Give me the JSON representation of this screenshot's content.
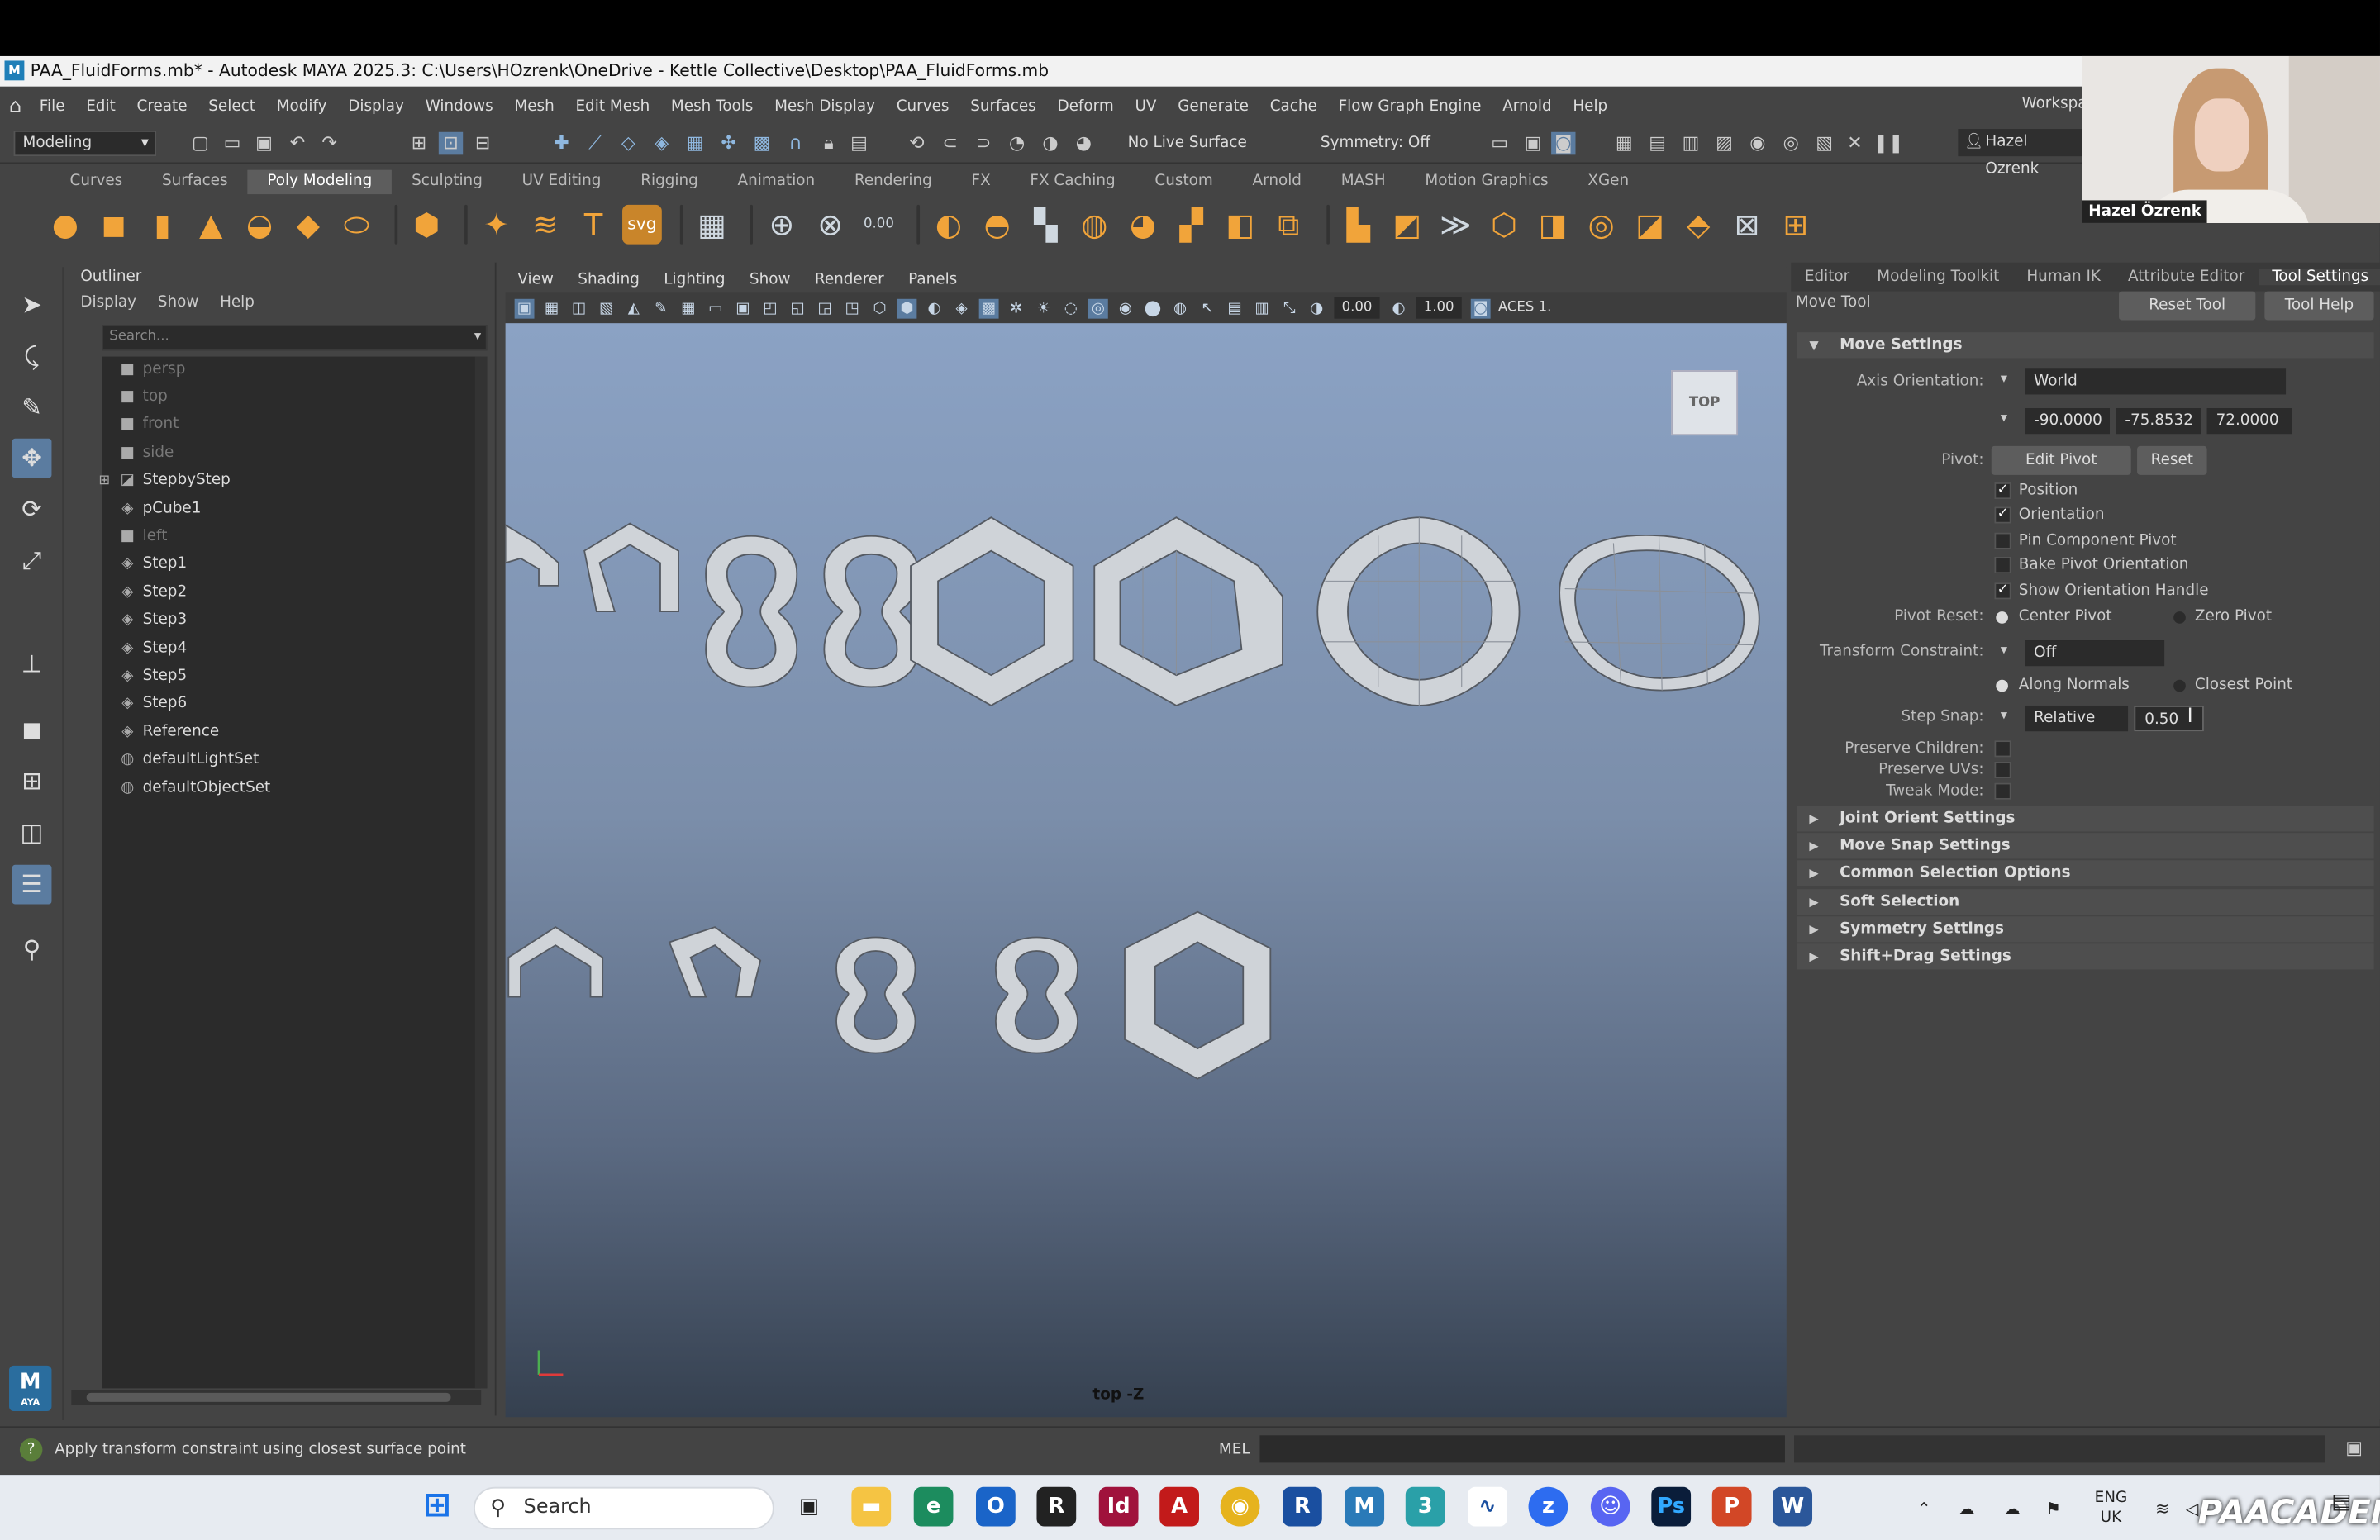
{
  "window": {
    "title": "PAA_FluidForms.mb* - Autodesk MAYA 2025.3: C:\\Users\\HOzrenk\\OneDrive - Kettle Collective\\Desktop\\PAA_FluidForms.mb",
    "logo": "M"
  },
  "menubar": {
    "items": [
      "File",
      "Edit",
      "Create",
      "Select",
      "Modify",
      "Display",
      "Windows",
      "Mesh",
      "Edit Mesh",
      "Mesh Tools",
      "Mesh Display",
      "Curves",
      "Surfaces",
      "Deform",
      "UV",
      "Generate",
      "Cache",
      "Flow Graph Engine",
      "Arnold",
      "Help"
    ],
    "workspace": "Workspac"
  },
  "statusline": {
    "mode": "Modeling",
    "live_surface": "No Live Surface",
    "symmetry": "Symmetry: Off",
    "user": "Hazel Ozrenk"
  },
  "shelf": {
    "tabs": [
      "Curves",
      "Surfaces",
      "Poly Modeling",
      "Sculpting",
      "UV Editing",
      "Rigging",
      "Animation",
      "Rendering",
      "FX",
      "FX Caching",
      "Custom",
      "Arnold",
      "MASH",
      "Motion Graphics",
      "XGen"
    ],
    "active": "Poly Modeling",
    "number_icon": "0.00"
  },
  "webcam": {
    "name": "Hazel Özrenk"
  },
  "outliner": {
    "title": "Outliner",
    "menu": [
      "Display",
      "Show",
      "Help"
    ],
    "search_placeholder": "Search...",
    "items": [
      {
        "label": "persp",
        "icon": "camera-icon",
        "dim": true
      },
      {
        "label": "top",
        "icon": "camera-icon",
        "dim": true
      },
      {
        "label": "front",
        "icon": "camera-icon",
        "dim": true
      },
      {
        "label": "side",
        "icon": "camera-icon",
        "dim": true
      },
      {
        "label": "StepbyStep",
        "icon": "group-icon",
        "dim": false
      },
      {
        "label": "pCube1",
        "icon": "mesh-icon",
        "dim": false
      },
      {
        "label": "left",
        "icon": "camera-icon",
        "dim": true
      },
      {
        "label": "Step1",
        "icon": "mesh-icon",
        "dim": false
      },
      {
        "label": "Step2",
        "icon": "mesh-icon",
        "dim": false
      },
      {
        "label": "Step3",
        "icon": "mesh-icon",
        "dim": false
      },
      {
        "label": "Step4",
        "icon": "mesh-icon",
        "dim": false
      },
      {
        "label": "Step5",
        "icon": "mesh-icon",
        "dim": false
      },
      {
        "label": "Step6",
        "icon": "mesh-icon",
        "dim": false
      },
      {
        "label": "Reference",
        "icon": "mesh-icon",
        "dim": false
      },
      {
        "label": "defaultLightSet",
        "icon": "set-icon",
        "dim": false
      },
      {
        "label": "defaultObjectSet",
        "icon": "set-icon",
        "dim": false
      }
    ]
  },
  "viewport": {
    "menu": [
      "View",
      "Shading",
      "Lighting",
      "Show",
      "Renderer",
      "Panels"
    ],
    "field1": "0.00",
    "field2": "1.00",
    "color_space": "ACES 1.",
    "viewcube": "TOP",
    "camera": "top -Z"
  },
  "toolsettings": {
    "tabs": [
      "Editor",
      "Modeling Toolkit",
      "Human IK",
      "Attribute Editor",
      "Tool Settings"
    ],
    "active": "Tool Settings",
    "tool_name": "Move Tool",
    "reset_tool": "Reset Tool",
    "tool_help": "Tool Help",
    "move_settings": "Move Settings",
    "axis_orientation_label": "Axis Orientation:",
    "axis_orientation": "World",
    "rot": [
      "-90.0000",
      "-75.8532",
      "72.0000"
    ],
    "pivot_label": "Pivot:",
    "edit_pivot": "Edit Pivot",
    "reset": "Reset",
    "checks": [
      {
        "label": "Position",
        "on": true
      },
      {
        "label": "Orientation",
        "on": true
      },
      {
        "label": "Pin Component Pivot",
        "on": false
      },
      {
        "label": "Bake Pivot Orientation",
        "on": false
      },
      {
        "label": "Show Orientation Handle",
        "on": true
      }
    ],
    "pivot_reset_label": "Pivot Reset:",
    "center_pivot": "Center Pivot",
    "zero_pivot": "Zero Pivot",
    "transform_constraint_label": "Transform Constraint:",
    "transform_constraint": "Off",
    "along_normals": "Along Normals",
    "closest_point": "Closest Point",
    "step_snap_label": "Step Snap:",
    "step_snap": "Relative",
    "step_value": "0.50",
    "preserve_children": "Preserve Children:",
    "preserve_uvs": "Preserve UVs:",
    "tweak_mode": "Tweak Mode:",
    "collapsed": [
      "Joint Orient Settings",
      "Move Snap Settings",
      "Common Selection Options",
      "Soft Selection",
      "Symmetry Settings",
      "Shift+Drag Settings"
    ]
  },
  "commandline": {
    "help": "Apply transform constraint using closest surface point",
    "mel": "MEL"
  },
  "taskbar": {
    "search": "Search",
    "lang1": "ENG",
    "lang2": "UK",
    "watermark": "PAACADEMY"
  }
}
